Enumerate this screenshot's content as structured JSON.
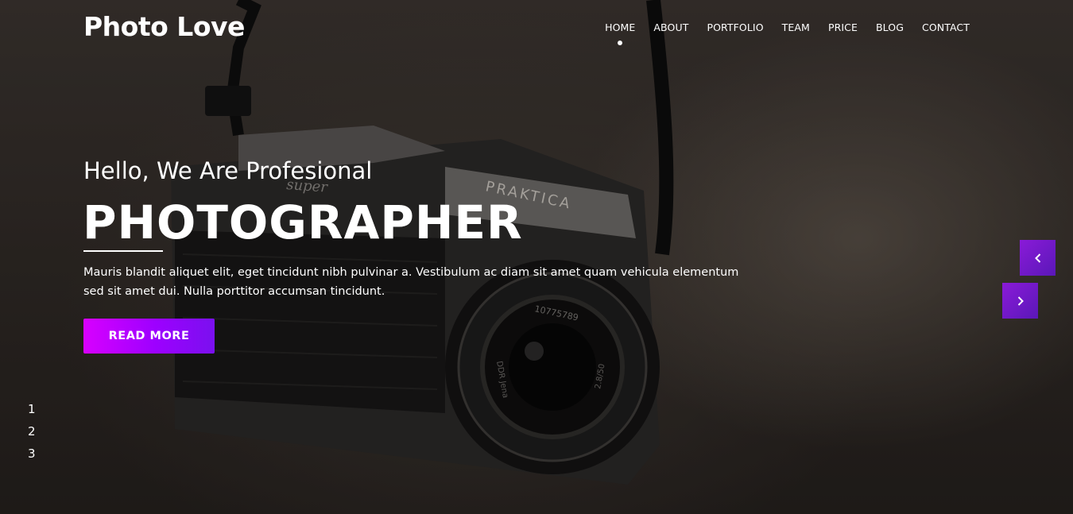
{
  "brand": {
    "logo_text": "Photo Love"
  },
  "nav": {
    "items": [
      {
        "label": "HOME",
        "active": true
      },
      {
        "label": "ABOUT"
      },
      {
        "label": "PORTFOLIO"
      },
      {
        "label": "TEAM"
      },
      {
        "label": "PRICE"
      },
      {
        "label": "BLOG"
      },
      {
        "label": "CONTACT"
      }
    ]
  },
  "hero": {
    "subtitle": "Hello, We Are Profesional",
    "headline": "PHOTOGRAPHER",
    "description": "Mauris blandit aliquet elit, eget tincidunt nibh pulvinar a. Vestibulum ac diam sit amet quam vehicula elementum sed sit amet dui. Nulla porttitor accumsan tincidunt.",
    "button_label": "READ MORE",
    "camera_text": {
      "brand": "PRAKTICA",
      "model": "super",
      "lens_serial": "10775789",
      "lens_name": "DDR Jena",
      "lens_spec": "2.8/50"
    }
  },
  "slider": {
    "prev_icon": "chevron-left-icon",
    "next_icon": "chevron-right-icon",
    "pages": [
      "1",
      "2",
      "3"
    ]
  },
  "colors": {
    "button_gradient_start": "#d800ff",
    "button_gradient_end": "#7a10ef",
    "arrow_purple": "#8a1ad8",
    "text": "#ffffff"
  }
}
